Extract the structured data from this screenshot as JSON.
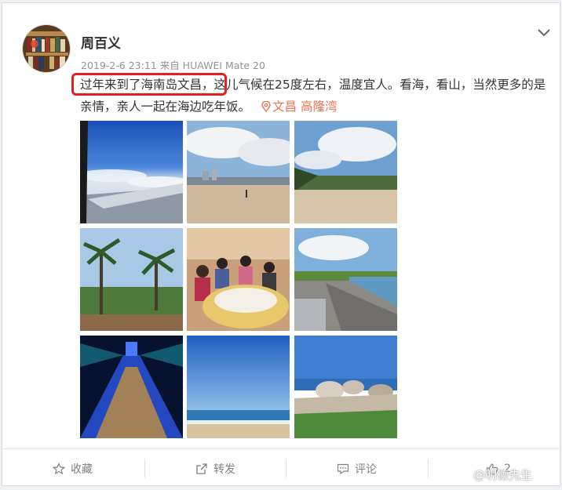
{
  "post": {
    "author": "周百义",
    "meta": "2019-2-6 23:11 来自 HUAWEI Mate 20",
    "text_highlighted": "过年来到了海南岛文昌，",
    "text_rest": "这儿气候在25度左右，温度宜人。看海，看山，当然更多的是亲情，亲人一起在海边吃年饭。",
    "location": "文昌 高隆湾"
  },
  "icons": {
    "more": "chevron-down-icon",
    "location": "location-pin-icon",
    "favorite": "star-icon",
    "repost": "share-icon",
    "comment": "comment-icon",
    "like": "thumbs-up-icon"
  },
  "actions": {
    "favorite_label": "收藏",
    "repost_label": "转发",
    "comment_label": "评论",
    "like_count": "2"
  },
  "watermark": "@明德先生",
  "colors": {
    "highlight_box": "#e31f1f",
    "location": "#eb7350",
    "meta": "#939393"
  }
}
